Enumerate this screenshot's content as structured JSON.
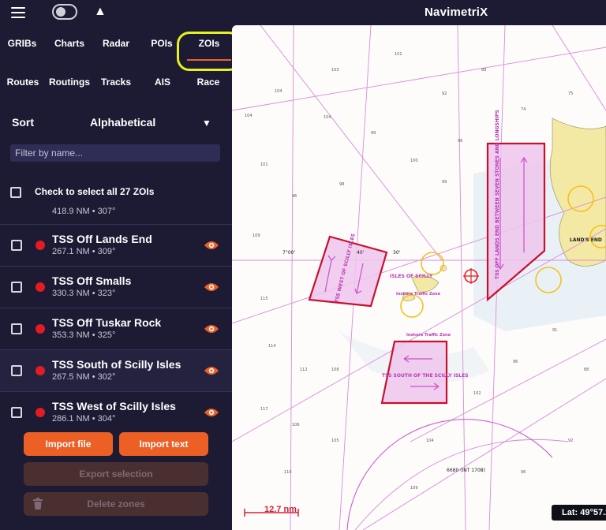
{
  "app": {
    "title": "NavimetriX"
  },
  "tabs_row1": [
    "GRIBs",
    "Charts",
    "Radar",
    "POIs",
    "ZOIs"
  ],
  "tabs_row2": [
    "Routes",
    "Routings",
    "Tracks",
    "AIS",
    "Race"
  ],
  "active_tab": "ZOIs",
  "sort": {
    "label": "Sort",
    "value": "Alphabetical"
  },
  "filter": {
    "placeholder": "Filter by name..."
  },
  "select_all": {
    "label": "Check to select all 27 ZOIs"
  },
  "partial_row_meta": "418.9 NM • 307°",
  "zones": [
    {
      "name": "TSS Off Lands End",
      "meta": "267.1 NM • 309°"
    },
    {
      "name": "TSS Off Smalls",
      "meta": "330.3 NM • 323°"
    },
    {
      "name": "TSS Off Tuskar Rock",
      "meta": "353.3 NM • 325°"
    },
    {
      "name": "TSS South of Scilly Isles",
      "meta": "267.5 NM • 302°"
    },
    {
      "name": "TSS West of Scilly Isles",
      "meta": "286.1 NM • 304°"
    }
  ],
  "buttons": {
    "import_file": "Import file",
    "import_text": "Import text",
    "export_selection": "Export selection",
    "delete_zones": "Delete zones"
  },
  "map": {
    "scale": "12.7 nm",
    "lat_readout": "Lat: 49°57.2",
    "labels": {
      "west_tss": "TSS WEST OF SCILLY ISLES",
      "south_tss": "TSS SOUTH OF THE SCILLY ISLES",
      "lands_end_tss": "TSS OFF LANDS END BETWEEN SEVEN STONES AND LONGSHIPS",
      "isles": "ISLES OF SCILLY",
      "inshore1": "Inshore Traffic Zone",
      "inshore2": "Inshore Traffic Zone",
      "land": "LAND'S END",
      "lat_tick": "7°00'",
      "min40": "40'",
      "min30": "30'",
      "chart_no": "6680 (INT 1708)"
    }
  },
  "colors": {
    "accent": "#ec5f25",
    "zone_red": "#c8102e",
    "panel_bg": "#1d1b33",
    "highlight": "#e5f21b"
  }
}
